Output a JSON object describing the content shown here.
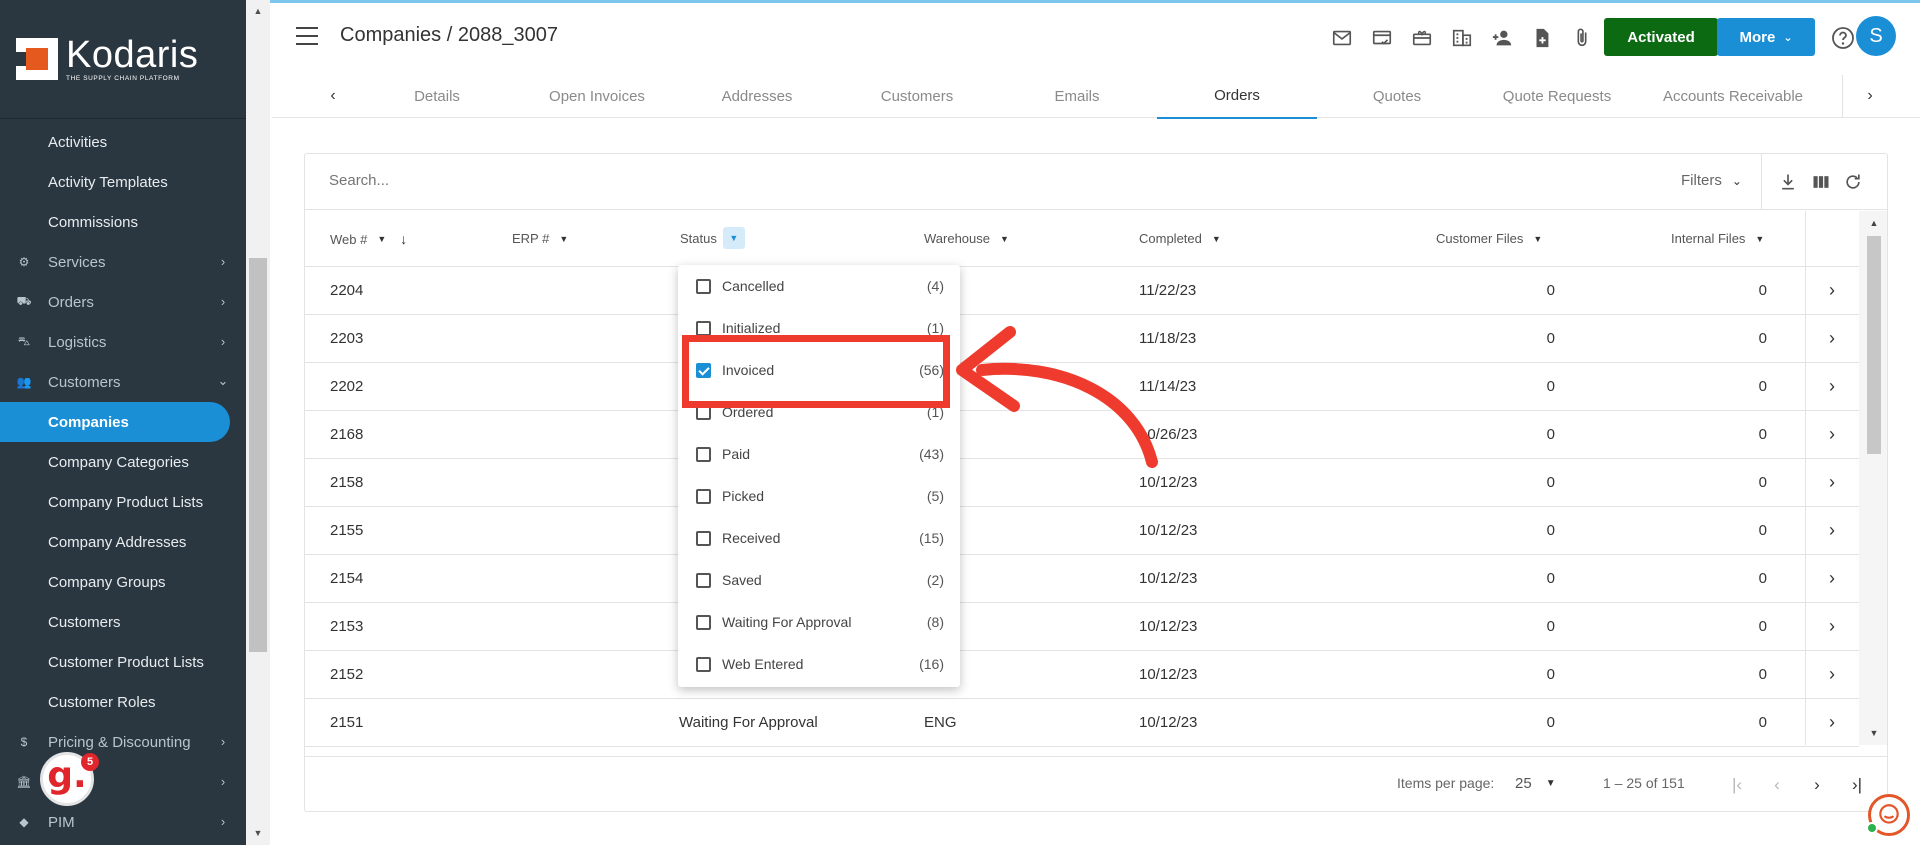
{
  "sidebar": {
    "logo_name": "Kodaris",
    "logo_tagline": "THE SUPPLY CHAIN PLATFORM",
    "items": [
      {
        "label": "Activities",
        "kind": "sub"
      },
      {
        "label": "Activity Templates",
        "kind": "sub"
      },
      {
        "label": "Commissions",
        "kind": "sub"
      },
      {
        "label": "Services",
        "kind": "group",
        "icon": "gears-icon"
      },
      {
        "label": "Orders",
        "kind": "group",
        "icon": "truck-icon"
      },
      {
        "label": "Logistics",
        "kind": "group",
        "icon": "van-icon"
      },
      {
        "label": "Customers",
        "kind": "group-open",
        "icon": "users-icon"
      },
      {
        "label": "Companies",
        "kind": "active"
      },
      {
        "label": "Company Categories",
        "kind": "sub"
      },
      {
        "label": "Company Product Lists",
        "kind": "sub"
      },
      {
        "label": "Company Addresses",
        "kind": "sub"
      },
      {
        "label": "Company Groups",
        "kind": "sub"
      },
      {
        "label": "Customers",
        "kind": "sub"
      },
      {
        "label": "Customer Product Lists",
        "kind": "sub"
      },
      {
        "label": "Customer Roles",
        "kind": "sub"
      },
      {
        "label": "Pricing & Discounting",
        "kind": "group",
        "icon": "dollar-icon"
      },
      {
        "label": "",
        "kind": "group",
        "icon": "bank-icon"
      },
      {
        "label": "PIM",
        "kind": "group",
        "icon": "tag-icon"
      }
    ],
    "badge_count": "5"
  },
  "header": {
    "page_title": "Companies / 2088_3007",
    "activated_label": "Activated",
    "more_label": "More",
    "avatar_initial": "S",
    "icons": [
      "mail-icon",
      "card-check-icon",
      "gift-card-icon",
      "building-icon",
      "add-person-icon",
      "add-file-icon",
      "paperclip-icon"
    ]
  },
  "tabs": [
    "Details",
    "Open Invoices",
    "Addresses",
    "Customers",
    "Emails",
    "Orders",
    "Quotes",
    "Quote Requests",
    "Accounts Receivable"
  ],
  "active_tab": "Orders",
  "toolbar": {
    "search_placeholder": "Search...",
    "filters_label": "Filters"
  },
  "table": {
    "columns": [
      "Web #",
      "ERP #",
      "Status",
      "Warehouse",
      "Completed",
      "Customer Files",
      "Internal Files"
    ],
    "rows": [
      {
        "web": "2204",
        "erp": "",
        "status": "",
        "warehouse": "",
        "completed": "11/22/23",
        "customer_files": "0",
        "internal_files": "0"
      },
      {
        "web": "2203",
        "erp": "",
        "status": "",
        "warehouse": "",
        "completed": "11/18/23",
        "customer_files": "0",
        "internal_files": "0"
      },
      {
        "web": "2202",
        "erp": "",
        "status": "",
        "warehouse": "",
        "completed": "11/14/23",
        "customer_files": "0",
        "internal_files": "0"
      },
      {
        "web": "2168",
        "erp": "",
        "status": "",
        "warehouse": "",
        "completed": "10/26/23",
        "customer_files": "0",
        "internal_files": "0"
      },
      {
        "web": "2158",
        "erp": "",
        "status": "",
        "warehouse": "",
        "completed": "10/12/23",
        "customer_files": "0",
        "internal_files": "0"
      },
      {
        "web": "2155",
        "erp": "",
        "status": "",
        "warehouse": "",
        "completed": "10/12/23",
        "customer_files": "0",
        "internal_files": "0"
      },
      {
        "web": "2154",
        "erp": "",
        "status": "",
        "warehouse": "",
        "completed": "10/12/23",
        "customer_files": "0",
        "internal_files": "0"
      },
      {
        "web": "2153",
        "erp": "",
        "status": "",
        "warehouse": "",
        "completed": "10/12/23",
        "customer_files": "0",
        "internal_files": "0"
      },
      {
        "web": "2152",
        "erp": "",
        "status": "",
        "warehouse": "",
        "completed": "10/12/23",
        "customer_files": "0",
        "internal_files": "0"
      },
      {
        "web": "2151",
        "erp": "",
        "status": "Waiting For Approval",
        "warehouse": "ENG",
        "completed": "10/12/23",
        "customer_files": "0",
        "internal_files": "0"
      }
    ]
  },
  "status_filter": {
    "options": [
      {
        "label": "Cancelled",
        "count": "(4)",
        "checked": false
      },
      {
        "label": "Initialized",
        "count": "(1)",
        "checked": false
      },
      {
        "label": "Invoiced",
        "count": "(56)",
        "checked": true
      },
      {
        "label": "Ordered",
        "count": "(1)",
        "checked": false
      },
      {
        "label": "Paid",
        "count": "(43)",
        "checked": false
      },
      {
        "label": "Picked",
        "count": "(5)",
        "checked": false
      },
      {
        "label": "Received",
        "count": "(15)",
        "checked": false
      },
      {
        "label": "Saved",
        "count": "(2)",
        "checked": false
      },
      {
        "label": "Waiting For Approval",
        "count": "(8)",
        "checked": false
      },
      {
        "label": "Web Entered",
        "count": "(16)",
        "checked": false
      }
    ]
  },
  "paginator": {
    "items_per_page_label": "Items per page:",
    "page_size": "25",
    "range_label": "1 – 25 of 151"
  },
  "colors": {
    "sidebar_bg": "#2a3740",
    "accent_blue": "#1a8fd6",
    "activated_green": "#0c6a12",
    "annotation_red": "#ef3b2d"
  }
}
